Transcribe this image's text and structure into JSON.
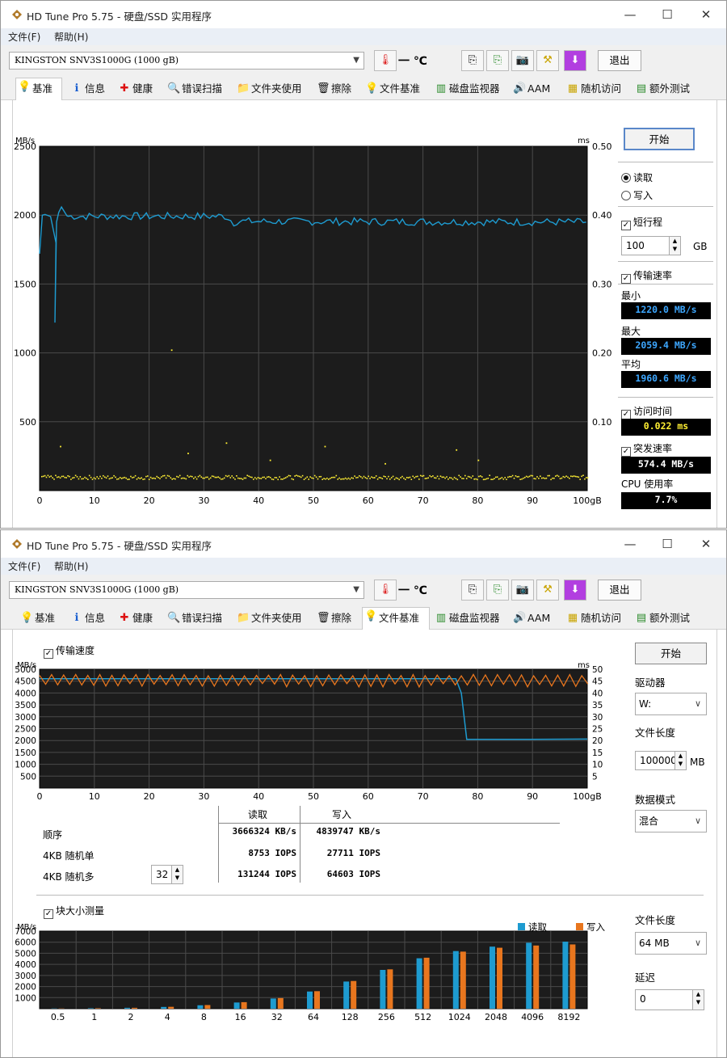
{
  "window1": {
    "title": "HD Tune Pro 5.75 - 硬盘/SSD 实用程序",
    "menu": [
      "文件(F)",
      "帮助(H)"
    ],
    "drive": "KINGSTON SNV3S1000G (1000 gB)",
    "temperature": "一 ℃",
    "exit_label": "退出",
    "tabs": [
      "基准",
      "信息",
      "健康",
      "错误扫描",
      "文件夹使用",
      "擦除",
      "文件基准",
      "磁盘监视器",
      "AAM",
      "随机访问",
      "额外测试"
    ],
    "active_tab": 0,
    "start_label": "开始",
    "read_label": "读取",
    "write_label": "写入",
    "short_stroke_label": "短行程",
    "short_stroke_value": "100",
    "short_stroke_unit": "GB",
    "transfer_rate_label": "传输速率",
    "min_label": "最小",
    "min_value": "1220.0 MB/s",
    "max_label": "最大",
    "max_value": "2059.4 MB/s",
    "avg_label": "平均",
    "avg_value": "1960.6 MB/s",
    "access_time_label": "访问时间",
    "access_time_value": "0.022 ms",
    "burst_label": "突发速率",
    "burst_value": "574.4 MB/s",
    "cpu_label": "CPU 使用率",
    "cpu_value": "7.7%"
  },
  "window2": {
    "title": "HD Tune Pro 5.75 - 硬盘/SSD 实用程序",
    "menu": [
      "文件(F)",
      "帮助(H)"
    ],
    "drive": "KINGSTON SNV3S1000G (1000 gB)",
    "temperature": "一 ℃",
    "exit_label": "退出",
    "tabs": [
      "基准",
      "信息",
      "健康",
      "错误扫描",
      "文件夹使用",
      "擦除",
      "文件基准",
      "磁盘监视器",
      "AAM",
      "随机访问",
      "额外测试"
    ],
    "active_tab": 6,
    "transfer_label": "传输速度",
    "start_label": "开始",
    "drive_label": "驱动器",
    "drive_value": "W:",
    "file_length_label": "文件长度",
    "file_length_value": "100000",
    "file_length_unit": "MB",
    "data_mode_label": "数据模式",
    "data_mode_value": "混合",
    "table": {
      "headers": [
        "读取",
        "写入"
      ],
      "rows": [
        {
          "label": "顺序",
          "read": "3666324 KB/s",
          "write": "4839747 KB/s"
        },
        {
          "label": "4KB 随机单",
          "read": "8753 IOPS",
          "write": "27711 IOPS"
        },
        {
          "label": "4KB 随机多",
          "read": "131244 IOPS",
          "write": "64603 IOPS"
        }
      ],
      "queue_depth": "32"
    },
    "block_size_label": "块大小测量",
    "block_file_length_label": "文件长度",
    "block_file_length_value": "64 MB",
    "delay_label": "延迟",
    "delay_value": "0"
  },
  "colors": {
    "read": "#1e9bd0",
    "write": "#e8761e",
    "chart_bg": "#1c1c1c",
    "yellow": "#ffef33"
  },
  "chart_data": [
    {
      "type": "line",
      "title": "",
      "ylabel": "MB/s",
      "y2label": "ms",
      "xlabel": "gB",
      "xlim": [
        0,
        100
      ],
      "ylim": [
        0,
        2500
      ],
      "y2lim": [
        0,
        0.5
      ],
      "xticks": [
        "0",
        "10",
        "20",
        "30",
        "40",
        "50",
        "60",
        "70",
        "80",
        "90",
        "100gB"
      ],
      "yticks": [
        "2500",
        "2000",
        "1500",
        "1000",
        "500"
      ],
      "y2ticks": [
        "0.50",
        "0.40",
        "0.30",
        "0.20",
        "0.10"
      ],
      "series": [
        {
          "values_x": [
            0,
            0.5,
            1,
            2,
            3,
            2.8,
            3.1,
            3.5,
            4,
            5,
            8,
            12,
            16,
            20,
            24,
            28,
            32,
            34,
            35,
            40,
            50,
            60,
            70,
            80,
            90,
            100
          ],
          "values_y": [
            1720,
            2000,
            2005,
            1990,
            1800,
            1220,
            1950,
            2020,
            2059,
            1995,
            1990,
            1995,
            1985,
            1995,
            1990,
            1995,
            1990,
            1995,
            1940,
            1960,
            1950,
            1945,
            1930,
            1945,
            1950,
            1950
          ]
        }
      ],
      "access_time_points_ms": 0.02
    },
    {
      "type": "line",
      "title": "",
      "ylabel": "MB/s",
      "y2label": "ms",
      "xlim": [
        0,
        100
      ],
      "ylim": [
        0,
        5000
      ],
      "y2lim": [
        0,
        50
      ],
      "xticks": [
        "0",
        "10",
        "20",
        "30",
        "40",
        "50",
        "60",
        "70",
        "80",
        "90",
        "100gB"
      ],
      "yticks": [
        "5000",
        "4500",
        "4000",
        "3500",
        "3000",
        "2500",
        "2000",
        "1500",
        "1000",
        "500"
      ],
      "y2ticks": [
        "50",
        "45",
        "40",
        "35",
        "30",
        "25",
        "20",
        "15",
        "10",
        "5"
      ],
      "series": [
        {
          "name": "读取",
          "values_x": [
            0,
            10,
            20,
            30,
            40,
            50,
            60,
            70,
            76,
            77,
            78,
            80,
            90,
            100
          ],
          "values_y": [
            4600,
            4600,
            4600,
            4600,
            4600,
            4600,
            4600,
            4600,
            4600,
            4000,
            2050,
            2050,
            2050,
            2060
          ]
        },
        {
          "name": "写入",
          "values_x": [
            0,
            100
          ],
          "values_y": [
            4750,
            4750
          ]
        }
      ]
    },
    {
      "type": "bar",
      "title": "",
      "ylabel": "MB/s",
      "ylim": [
        0,
        7000
      ],
      "yticks": [
        "7000",
        "6000",
        "5000",
        "4000",
        "3000",
        "2000",
        "1000"
      ],
      "categories": [
        "0.5",
        "1",
        "2",
        "4",
        "8",
        "16",
        "32",
        "64",
        "128",
        "256",
        "512",
        "1024",
        "2048",
        "4096",
        "8192"
      ],
      "series": [
        {
          "name": "读取",
          "values": [
            20,
            40,
            80,
            160,
            310,
            560,
            920,
            1550,
            2450,
            3500,
            4550,
            5200,
            5600,
            5950,
            6050
          ]
        },
        {
          "name": "写入",
          "values": [
            20,
            40,
            80,
            170,
            330,
            590,
            960,
            1580,
            2500,
            3550,
            4600,
            5150,
            5500,
            5700,
            5800
          ]
        }
      ]
    }
  ]
}
